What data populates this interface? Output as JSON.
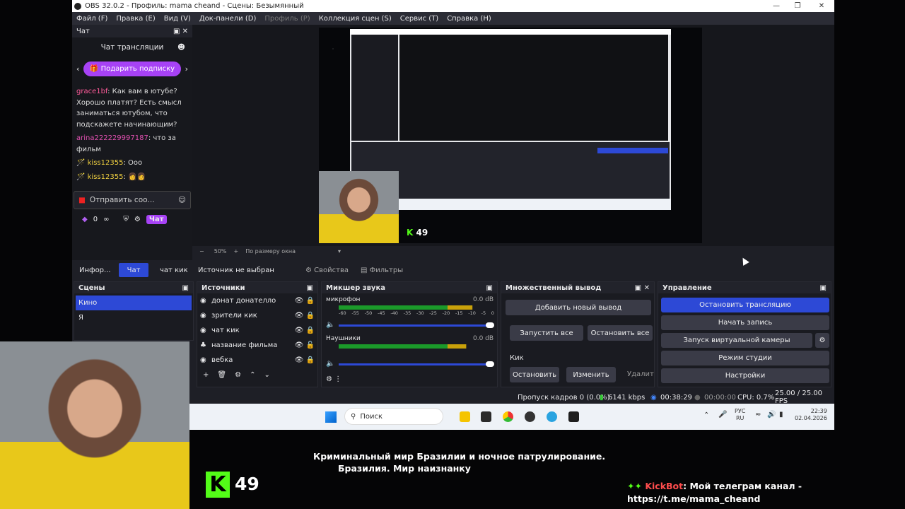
{
  "window": {
    "title": "OBS 32.0.2 - Профиль: mama cheand - Сцены: Безымянный"
  },
  "menu": [
    "Файл (F)",
    "Правка (E)",
    "Вид (V)",
    "Док-панели (D)",
    "Профиль (P)",
    "Коллекция сцен (S)",
    "Сервис (T)",
    "Справка (H)"
  ],
  "chat": {
    "dock_title": "Чат",
    "header": "Чат трансляции",
    "gift_button": "Подарить подписку",
    "messages": [
      {
        "user": "grace1bf",
        "text": ": Как вам в ютубе? Хорошо платят? Есть смысл заниматься ютубом, что подскажете начинающим?"
      },
      {
        "user": "arina222229997187",
        "text": ": что за фильм"
      },
      {
        "user": "kiss12355",
        "text": ": Ооо"
      },
      {
        "user": "kiss12355",
        "text": ": "
      }
    ],
    "input_placeholder": "Отправить соо...",
    "counter": "0",
    "tab_send": "Чат"
  },
  "preview": {
    "zoom": "50%",
    "fit": "По размеру окна"
  },
  "tabs": {
    "info": "Инфор...",
    "chat": "Чат",
    "kick_chat": "чат кик",
    "no_source": "Источник не выбран",
    "properties": "Свойства",
    "filters": "Фильтры"
  },
  "scenes": {
    "title": "Сцены",
    "items": [
      "Кино",
      "Я"
    ]
  },
  "sources": {
    "title": "Источники",
    "items": [
      "донат донателло",
      "зрители кик",
      "чат кик",
      "название фильма",
      "вебка"
    ]
  },
  "mixer": {
    "title": "Микшер звука",
    "tracks": [
      {
        "name": "микрофон",
        "db": "0.0 dB",
        "level": 0.86
      },
      {
        "name": "Наушники",
        "db": "0.0 dB",
        "level": 0.82
      }
    ],
    "scale": [
      "-60",
      "-55",
      "-50",
      "-45",
      "-40",
      "-35",
      "-30",
      "-25",
      "-20",
      "-15",
      "-10",
      "-5",
      "0"
    ]
  },
  "multi": {
    "title": "Множественный вывод",
    "add": "Добавить новый вывод",
    "start_all": "Запустить все",
    "stop_all": "Остановить все",
    "target": "Кик",
    "stop": "Остановить",
    "edit": "Изменить",
    "delete": "Удалит"
  },
  "controls": {
    "title": "Управление",
    "stop_stream": "Остановить трансляцию",
    "start_rec": "Начать запись",
    "virtual_cam": "Запуск виртуальной камеры",
    "studio": "Режим студии",
    "settings": "Настройки"
  },
  "status": {
    "dropped": "Пропуск кадров 0 (0.0%)",
    "bitrate": "6141 kbps",
    "live": "00:38:29",
    "rec": "00:00:00",
    "cpu": "CPU: 0.7%",
    "fps": "25.00 / 25.00 FPS"
  },
  "taskbar": {
    "search": "Поиск",
    "lang1": "РУС",
    "lang2": "RU",
    "time": "22:39",
    "date": "02.04.2026"
  },
  "overlay": {
    "movie_line1": "Криминальный мир Бразилии и ночное патрулирование.",
    "movie_line2": "Бразилия. Мир наизнанку",
    "viewers": "49",
    "bot_name": "KickBot",
    "bot_text": ": Мой телеграм канал -",
    "bot_link": "https://t.me/mama_cheand"
  },
  "colors": {
    "accent": "#2d49d6",
    "kick": "#53fc18",
    "gift": "#a742f5"
  }
}
